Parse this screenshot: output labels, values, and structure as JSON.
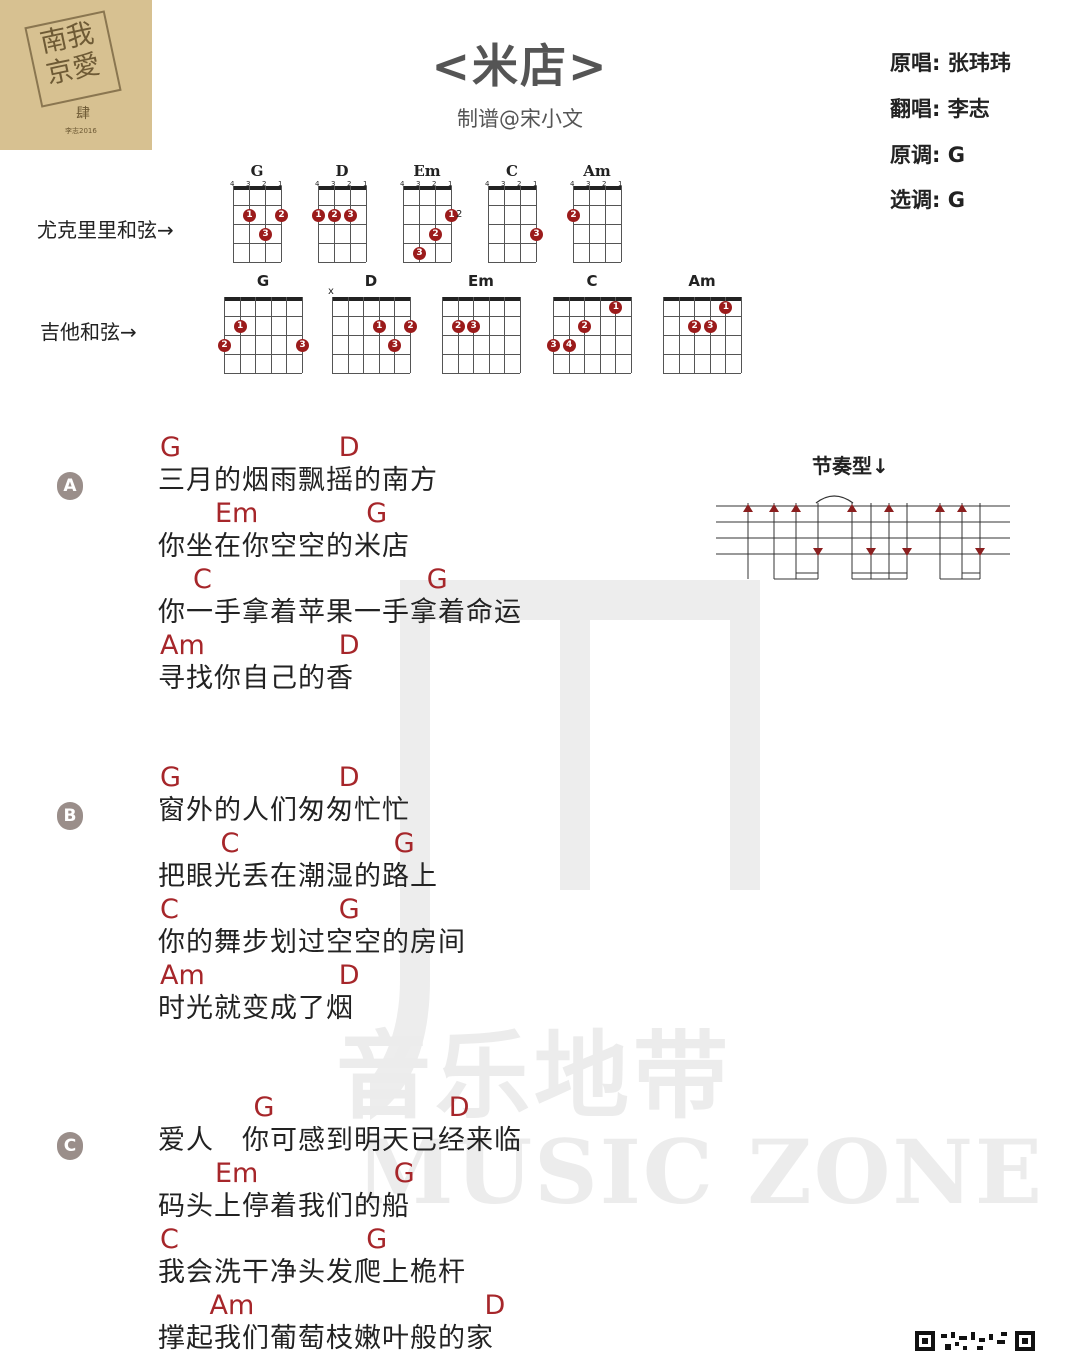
{
  "cover": {
    "line1": "南我",
    "line2": "京愛",
    "small": "肆",
    "tiny": "李志2016"
  },
  "title": "<米店>",
  "subtitle": "制谱@宋小文",
  "info": [
    {
      "label": "原唱:",
      "value": "张玮玮"
    },
    {
      "label": "翻唱:",
      "value": "李志"
    },
    {
      "label": "原调:",
      "value": "G"
    },
    {
      "label": "选调:",
      "value": "G"
    }
  ],
  "ukulele": {
    "label": "尤克里里和弦→",
    "chords": [
      {
        "name": "G",
        "string_numbers": [
          "4",
          "3",
          "2",
          "1"
        ],
        "dots": [
          {
            "s": 1,
            "f": 2,
            "n": "1"
          },
          {
            "s": 3,
            "f": 2,
            "n": "2"
          },
          {
            "s": 2,
            "f": 3,
            "n": "3"
          }
        ]
      },
      {
        "name": "D",
        "string_numbers": [
          "4",
          "3",
          "2",
          "1"
        ],
        "dots": [
          {
            "s": 0,
            "f": 2,
            "n": "1"
          },
          {
            "s": 1,
            "f": 2,
            "n": "2"
          },
          {
            "s": 2,
            "f": 2,
            "n": "3"
          }
        ]
      },
      {
        "name": "Em",
        "string_numbers": [
          "4",
          "3",
          "2",
          "1"
        ],
        "dots": [
          {
            "s": 3,
            "f": 2,
            "n": "1"
          },
          {
            "s": 2,
            "f": 3,
            "n": "2"
          },
          {
            "s": 1,
            "f": 4,
            "n": "3"
          }
        ],
        "fret_marker": "2"
      },
      {
        "name": "C",
        "string_numbers": [
          "4",
          "3",
          "2",
          "1"
        ],
        "dots": [
          {
            "s": 3,
            "f": 3,
            "n": "3"
          }
        ]
      },
      {
        "name": "Am",
        "string_numbers": [
          "4",
          "3",
          "2",
          "1"
        ],
        "dots": [
          {
            "s": 0,
            "f": 2,
            "n": "2"
          }
        ]
      }
    ]
  },
  "guitar": {
    "label": "吉他和弦→",
    "chords": [
      {
        "name": "G",
        "mute": "",
        "dots": [
          {
            "s": 1,
            "f": 2,
            "n": "1"
          },
          {
            "s": 0,
            "f": 3,
            "n": "2"
          },
          {
            "s": 5,
            "f": 3,
            "n": "3"
          }
        ]
      },
      {
        "name": "D",
        "mute": "x",
        "dots": [
          {
            "s": 3,
            "f": 2,
            "n": "1"
          },
          {
            "s": 5,
            "f": 2,
            "n": "2"
          },
          {
            "s": 4,
            "f": 3,
            "n": "3"
          }
        ]
      },
      {
        "name": "Em",
        "mute": "",
        "dots": [
          {
            "s": 1,
            "f": 2,
            "n": "2"
          },
          {
            "s": 2,
            "f": 2,
            "n": "3"
          }
        ]
      },
      {
        "name": "C",
        "mute": "",
        "dots": [
          {
            "s": 4,
            "f": 1,
            "n": "1"
          },
          {
            "s": 2,
            "f": 2,
            "n": "2"
          },
          {
            "s": 0,
            "f": 3,
            "n": "3"
          },
          {
            "s": 1,
            "f": 3,
            "n": "4"
          }
        ]
      },
      {
        "name": "Am",
        "mute": "",
        "dots": [
          {
            "s": 4,
            "f": 1,
            "n": "1"
          },
          {
            "s": 2,
            "f": 2,
            "n": "2"
          },
          {
            "s": 3,
            "f": 2,
            "n": "3"
          }
        ]
      }
    ]
  },
  "rhythm_label": "节奏型↓",
  "watermark": {
    "text": "音乐地带",
    "sub": "MUSIC ZONE"
  },
  "sections": [
    {
      "badge": "A",
      "lines": [
        {
          "chords": [
            {
              "c": "G",
              "at": 0
            },
            {
              "c": "D",
              "at": 6.5
            }
          ],
          "text": "三月的烟雨飘摇的南方"
        },
        {
          "chords": [
            {
              "c": "Em",
              "at": 2
            },
            {
              "c": "G",
              "at": 7.5
            }
          ],
          "text": "你坐在你空空的米店"
        },
        {
          "chords": [
            {
              "c": "C",
              "at": 1.2
            },
            {
              "c": "G",
              "at": 9.7
            }
          ],
          "text": "你一手拿着苹果一手拿着命运"
        },
        {
          "chords": [
            {
              "c": "Am",
              "at": 0
            },
            {
              "c": "D",
              "at": 6.5
            }
          ],
          "text": "寻找你自己的香"
        }
      ]
    },
    {
      "badge": "B",
      "lines": [
        {
          "chords": [
            {
              "c": "G",
              "at": 0
            },
            {
              "c": "D",
              "at": 6.5
            }
          ],
          "text": "窗外的人们匆匆忙忙"
        },
        {
          "chords": [
            {
              "c": "C",
              "at": 2.2
            },
            {
              "c": "G",
              "at": 8.5
            }
          ],
          "text": "把眼光丢在潮湿的路上"
        },
        {
          "chords": [
            {
              "c": "C",
              "at": 0
            },
            {
              "c": "G",
              "at": 6.5
            }
          ],
          "text": "你的舞步划过空空的房间"
        },
        {
          "chords": [
            {
              "c": "Am",
              "at": 0
            },
            {
              "c": "D",
              "at": 6.5
            }
          ],
          "text": "时光就变成了烟"
        }
      ]
    },
    {
      "badge": "C",
      "lines": [
        {
          "chords": [
            {
              "c": "G",
              "at": 3.4
            },
            {
              "c": "D",
              "at": 10.5
            }
          ],
          "text": "爱人　你可感到明天已经来临"
        },
        {
          "chords": [
            {
              "c": "Em",
              "at": 2
            },
            {
              "c": "G",
              "at": 8.5
            }
          ],
          "text": "码头上停着我们的船"
        },
        {
          "chords": [
            {
              "c": "C",
              "at": 0
            },
            {
              "c": "G",
              "at": 7.5
            }
          ],
          "text": "我会洗干净头发爬上桅杆"
        },
        {
          "chords": [
            {
              "c": "Am",
              "at": 1.8
            },
            {
              "c": "D",
              "at": 11.8
            }
          ],
          "text": "撑起我们葡萄枝嫩叶般的家"
        }
      ]
    }
  ]
}
